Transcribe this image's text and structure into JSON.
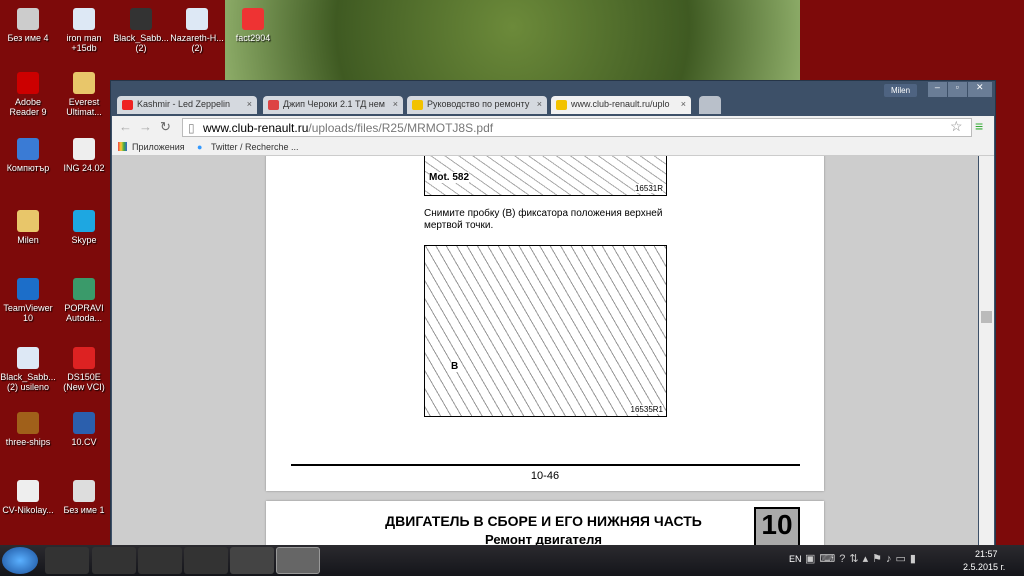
{
  "desktop": {
    "icons": [
      {
        "label": "Без име 4",
        "color": "#ccc"
      },
      {
        "label": "iron man +15db",
        "color": "#dde8f5"
      },
      {
        "label": "Black_Sabb... (2)",
        "color": "#333"
      },
      {
        "label": "Nazareth-H... (2)",
        "color": "#dde8f5"
      },
      {
        "label": "fact2904",
        "color": "#e33"
      },
      {
        "label": "Adobe Reader 9",
        "color": "#c00"
      },
      {
        "label": "Everest Ultimat...",
        "color": "#e8c66a"
      },
      {
        "label": "Компютър",
        "color": "#3a7bd5"
      },
      {
        "label": "ING 24.02",
        "color": "#eee"
      },
      {
        "label": "Milen",
        "color": "#e8c66a"
      },
      {
        "label": "Skype",
        "color": "#1ea7e1"
      },
      {
        "label": "TeamViewer 10",
        "color": "#1c6ec9"
      },
      {
        "label": "POPRAVI Autoda...",
        "color": "#3a9a6a"
      },
      {
        "label": "Black_Sabb... (2) usileno",
        "color": "#dde8f5"
      },
      {
        "label": "DS150E (New VCI)",
        "color": "#d22"
      },
      {
        "label": "three-ships",
        "color": "#a0601a"
      },
      {
        "label": "10.CV",
        "color": "#2b5fad"
      },
      {
        "label": "CV-Nikolay...",
        "color": "#eee"
      },
      {
        "label": "Без име 1",
        "color": "#ddd"
      }
    ]
  },
  "browser": {
    "user": "Milen",
    "tabs": [
      {
        "title": "Kashmir - Led Zeppelin",
        "favicon": "#e22"
      },
      {
        "title": "Джип Чероки 2.1 ТД нем",
        "favicon": "#d44"
      },
      {
        "title": "Руководство по ремонту",
        "favicon": "#f2c200"
      },
      {
        "title": "www.club-renault.ru/uplo",
        "favicon": "#f2c200"
      }
    ],
    "url_host": "www.club-renault.ru",
    "url_path": "/uploads/files/R25/MRMOTJ8S.pdf",
    "bookmarks": [
      "Приложения",
      "Twitter / Recherche ..."
    ]
  },
  "pdf": {
    "fig1_label": "Mot. 582",
    "fig1_code": "16531R",
    "instruction": "Снимите пробку (B) фиксатора положения верхней мертвой точки.",
    "fig2_label": "B",
    "fig2_code": "16535R1",
    "page_number": "10-46",
    "next_heading": "ДВИГАТЕЛЬ В СБОРЕ И ЕГО НИЖНЯЯ ЧАСТЬ",
    "next_subheading": "Ремонт двигателя",
    "section_box": "10"
  },
  "taskbar": {
    "lang": "EN",
    "time": "21:57",
    "date": "2.5.2015 г."
  }
}
